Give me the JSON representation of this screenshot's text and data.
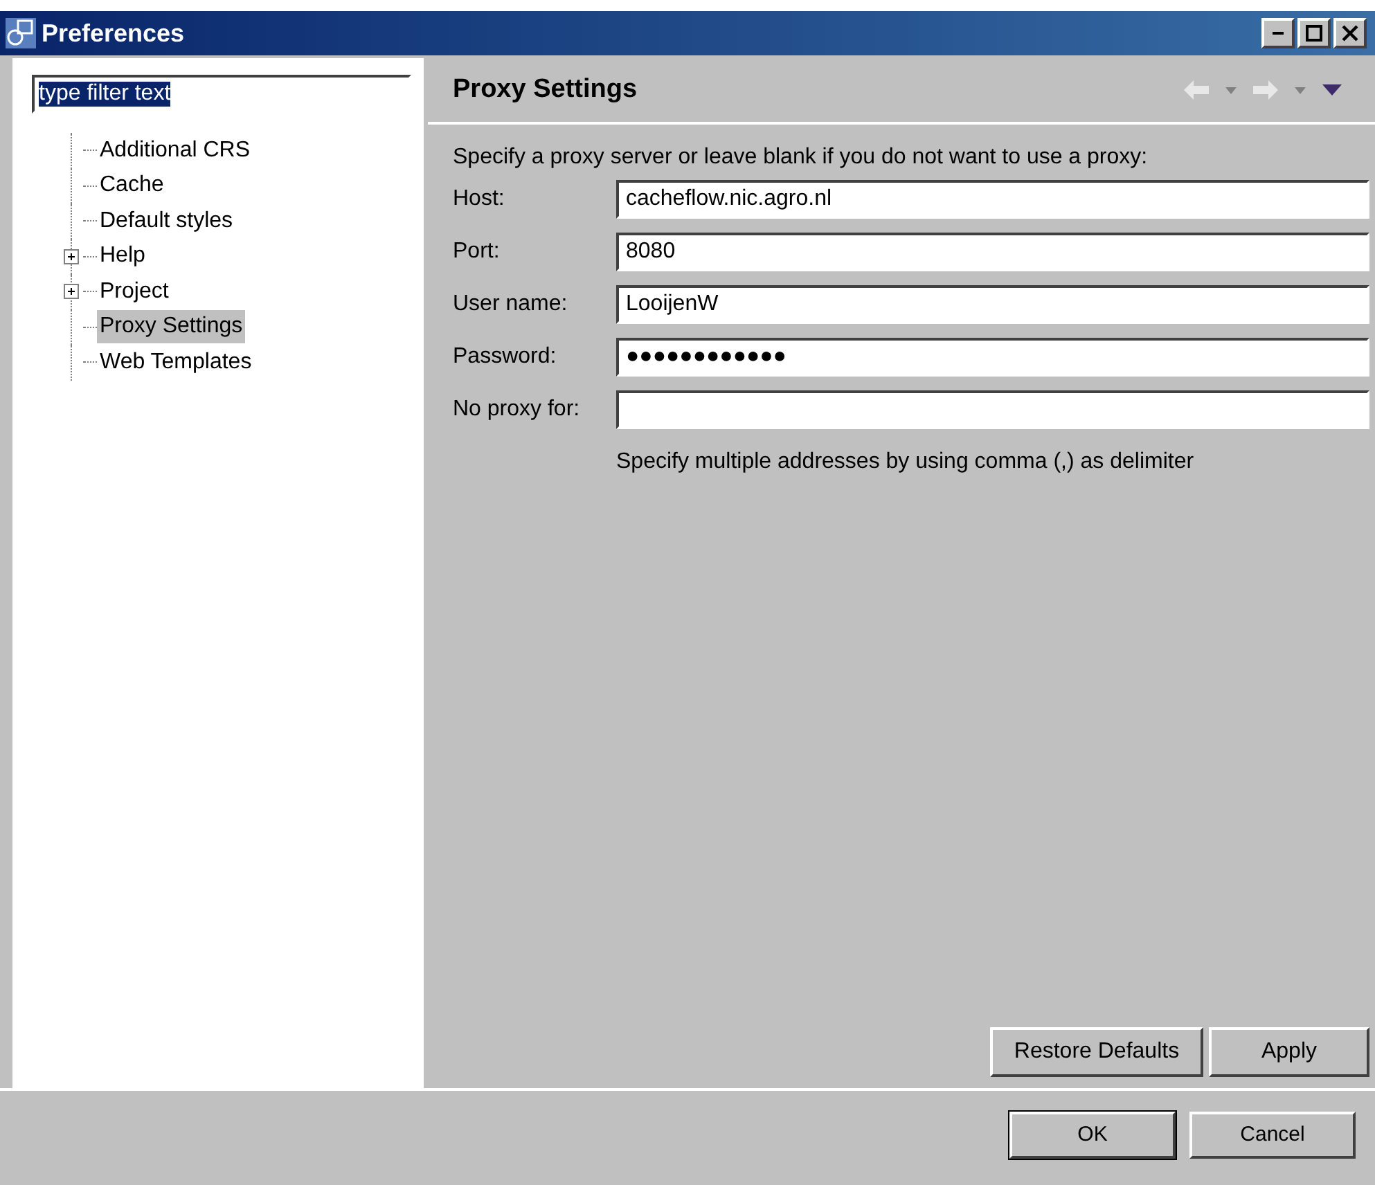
{
  "window": {
    "title": "Preferences"
  },
  "filter": {
    "value": "type filter text"
  },
  "tree": [
    {
      "label": "Additional CRS",
      "expandable": false,
      "selected": false
    },
    {
      "label": "Cache",
      "expandable": false,
      "selected": false
    },
    {
      "label": "Default styles",
      "expandable": false,
      "selected": false
    },
    {
      "label": "Help",
      "expandable": true,
      "selected": false
    },
    {
      "label": "Project",
      "expandable": true,
      "selected": false
    },
    {
      "label": "Proxy Settings",
      "expandable": false,
      "selected": true
    },
    {
      "label": "Web Templates",
      "expandable": false,
      "selected": false
    }
  ],
  "page": {
    "title": "Proxy Settings",
    "intro": "Specify a proxy server or leave blank if you do not want to use a proxy:",
    "fields": [
      {
        "label": "Host:",
        "value": "cacheflow.nic.agro.nl"
      },
      {
        "label": "Port:",
        "value": "8080"
      },
      {
        "label": "User name:",
        "value": "LooijenW"
      },
      {
        "label": "Password:",
        "value": "●●●●●●●●●●●●"
      },
      {
        "label": "No proxy for:"
      }
    ],
    "hint": "Specify multiple addresses by using comma (,) as delimiter",
    "buttons": [
      "Restore Defaults",
      "Apply"
    ]
  },
  "buttons": [
    "OK",
    "Cancel"
  ]
}
